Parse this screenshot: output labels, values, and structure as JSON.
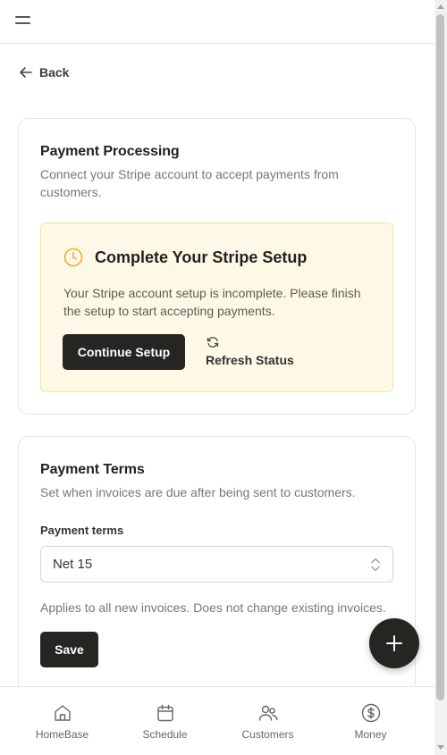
{
  "nav": {
    "back_label": "Back"
  },
  "payment_processing": {
    "title": "Payment Processing",
    "description": "Connect your Stripe account to accept payments from customers.",
    "alert": {
      "title": "Complete Your Stripe Setup",
      "description": "Your Stripe account setup is incomplete. Please finish the setup to start accepting payments.",
      "continue_label": "Continue Setup",
      "refresh_label": "Refresh Status",
      "icon": "clock-icon",
      "icon_color": "#f0a93b",
      "background": "#fef9e6"
    }
  },
  "payment_terms": {
    "title": "Payment Terms",
    "description": "Set when invoices are due after being sent to customers.",
    "field_label": "Payment terms",
    "selected_value": "Net 15",
    "helper": "Applies to all new invoices. Does not change existing invoices.",
    "save_label": "Save"
  },
  "bottom_nav": {
    "items": [
      {
        "label": "HomeBase",
        "icon": "home-icon"
      },
      {
        "label": "Schedule",
        "icon": "calendar-icon"
      },
      {
        "label": "Customers",
        "icon": "users-icon"
      },
      {
        "label": "Money",
        "icon": "dollar-icon"
      }
    ]
  },
  "colors": {
    "primary_button": "#262522",
    "muted_text": "#7a7773"
  }
}
